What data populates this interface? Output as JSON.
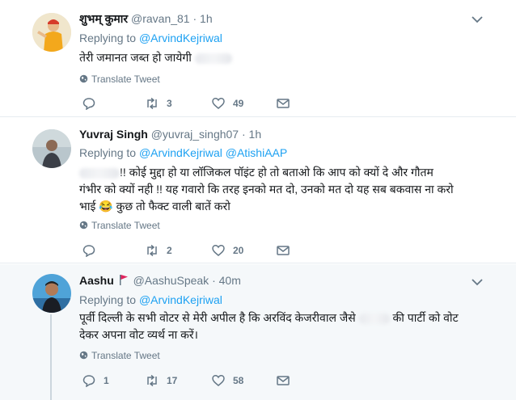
{
  "tweets": [
    {
      "name": "शुभम् कुमार",
      "handle": "@ravan_81",
      "time": "1h",
      "replying_prefix": "Replying to",
      "replying_to": [
        "@ArvindKejriwal"
      ],
      "text": "तेरी जमानत जब्त हो जायेगी",
      "translate": "Translate Tweet",
      "replies": "",
      "retweets": "3",
      "likes": "49"
    },
    {
      "name": "Yuvraj Singh",
      "handle": "@yuvraj_singh07",
      "time": "1h",
      "replying_prefix": "Replying to",
      "replying_to": [
        "@ArvindKejriwal",
        "@AtishiAAP"
      ],
      "text_line1": "!! कोई मुद्दा हो या लॉजिकल पॉइंट हो तो बताओ कि आप को क्यों दे और गौतम",
      "text_line2": "गंभीर को क्यों नही !! यह गवारो कि तरह इनको मत दो, उनको मत दो यह सब बकवास ना करो",
      "text_line3a": "भाई",
      "emoji": "😂",
      "text_line3b": "कुछ तो फैक्ट वाली बातें करो",
      "translate": "Translate Tweet",
      "replies": "",
      "retweets": "2",
      "likes": "20"
    },
    {
      "name": "Aashu",
      "handle": "@AashuSpeak",
      "time": "40m",
      "replying_prefix": "Replying to",
      "replying_to": [
        "@ArvindKejriwal"
      ],
      "text_line1a": "पूर्वी दिल्ली के सभी वोटर से मेरी अपील है कि अरविंद केजरीवाल जैसे",
      "text_line1b": "की पार्टी को वोट",
      "text_line2": "देकर अपना वोट व्यर्थ ना करें।",
      "translate": "Translate Tweet",
      "replies": "1",
      "retweets": "17",
      "likes": "58"
    }
  ],
  "dot": "·",
  "colors": {
    "link": "#1da1f2",
    "muted": "#657786",
    "flag": "#e0245e"
  }
}
